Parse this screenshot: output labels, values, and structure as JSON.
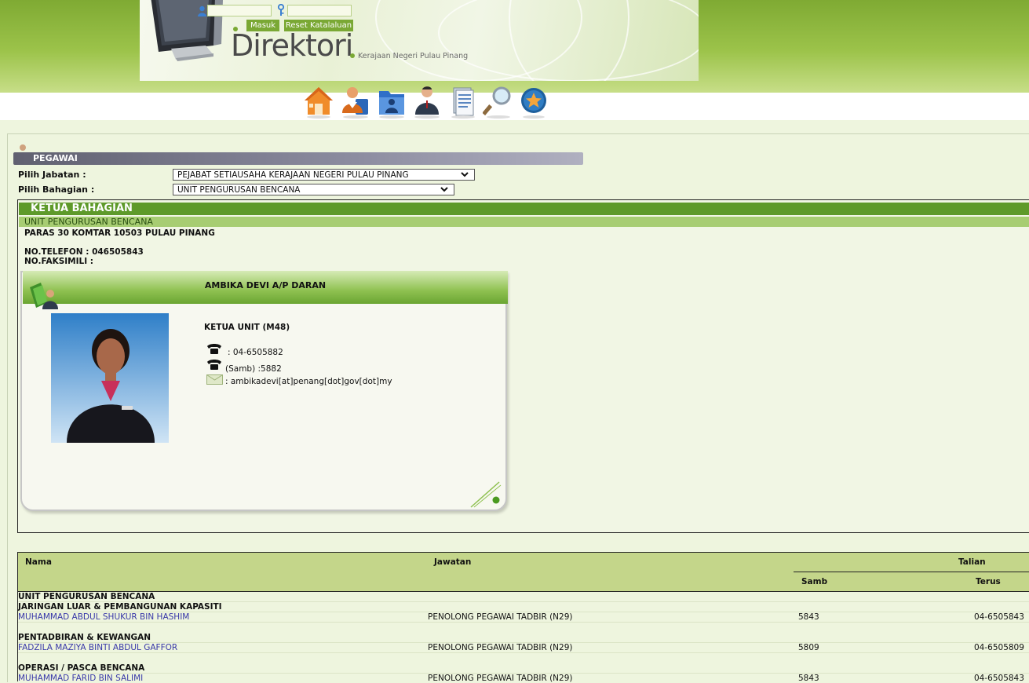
{
  "header": {
    "login_button": "Masuk",
    "reset_button": "Reset Katalaluan",
    "logo_text": "Direktori",
    "tagline": "Kerajaan Negeri Pulau Pinang"
  },
  "nav": {
    "icons": [
      "home-icon",
      "staff-directory-icon",
      "department-folder-icon",
      "officer-icon",
      "document-list-icon",
      "search-icon",
      "favorite-star-icon"
    ]
  },
  "section": {
    "title": "PEGAWAI",
    "jabatan_label": "Pilih Jabatan :",
    "jabatan_value": "PEJABAT SETIAUSAHA KERAJAAN NEGERI PULAU PINANG",
    "bahagian_label": "Pilih Bahagian :",
    "bahagian_value": "UNIT PENGURUSAN BENCANA"
  },
  "ketua": {
    "heading": "KETUA BAHAGIAN",
    "unit": "UNIT PENGURUSAN BENCANA",
    "address": "PARAS 30 KOMTAR 10503 PULAU PINANG",
    "telefon": "NO.TELEFON : 046505843",
    "faksimili": "NO.FAKSIMILI :"
  },
  "card": {
    "name": "AMBIKA DEVI A/P DARAN",
    "position": "KETUA UNIT (M48)",
    "phone": ": 04-6505882",
    "extension": "(Samb) :5882",
    "email": ": ambikadevi[at]penang[dot]gov[dot]my"
  },
  "table": {
    "headers": {
      "nama": "Nama",
      "jawatan": "Jawatan",
      "talian": "Talian",
      "samb": "Samb",
      "terus": "Terus"
    },
    "unit": "UNIT PENGURUSAN BENCANA",
    "groups": [
      {
        "name": "JARINGAN LUAR & PEMBANGUNAN KAPASITI",
        "rows": [
          {
            "nama": "MUHAMMAD ABDUL SHUKUR BIN HASHIM",
            "jawatan": "PENOLONG PEGAWAI TADBIR (N29)",
            "samb": "5843",
            "terus": "04-6505843"
          }
        ]
      },
      {
        "name": "PENTADBIRAN & KEWANGAN",
        "rows": [
          {
            "nama": "FADZILA MAZIYA BINTI ABDUL GAFFOR",
            "jawatan": "PENOLONG PEGAWAI TADBIR (N29)",
            "samb": "5809",
            "terus": "04-6505809"
          }
        ]
      },
      {
        "name": "OPERASI / PASCA BENCANA",
        "rows": [
          {
            "nama": "MUHAMMAD FARID BIN SALIMI",
            "jawatan": "PENOLONG PEGAWAI TADBIR (N29)",
            "samb": "5843",
            "terus": "04-6505843"
          }
        ]
      }
    ]
  }
}
